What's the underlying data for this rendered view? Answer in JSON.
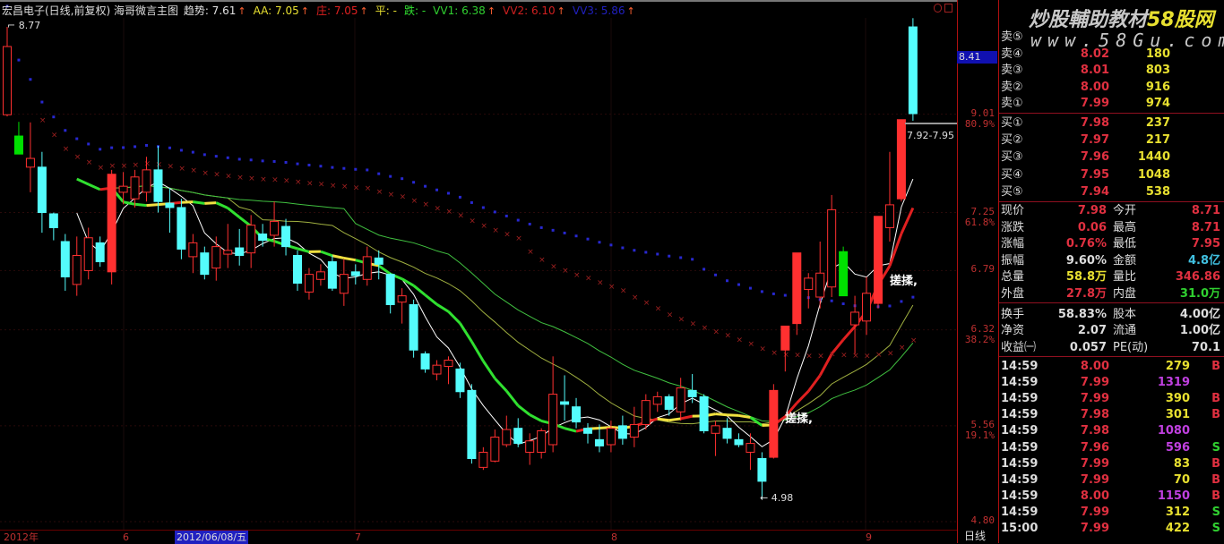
{
  "title": {
    "stock": "宏昌电子(日线,前复权) 海哥微言主图",
    "items": [
      {
        "text": "趋势: 7.61",
        "color": "#e0e0e0"
      },
      {
        "text": "AA: 7.05",
        "color": "#e8e030"
      },
      {
        "text": "庄: 7.05",
        "color": "#e02020"
      },
      {
        "text": "平: -",
        "color": "#e8e030"
      },
      {
        "text": "跌: -",
        "color": "#30e030"
      },
      {
        "text": "VV1: 6.38",
        "color": "#30d030"
      },
      {
        "text": "VV2: 6.10",
        "color": "#d02020"
      },
      {
        "text": "VV3: 5.86",
        "color": "#2020c0"
      }
    ],
    "arrow": "↑"
  },
  "axis": {
    "ticks": [
      {
        "value": 9.01,
        "label": "9.01",
        "pct": "80.9%"
      },
      {
        "value": 7.25,
        "label": "7.25",
        "pct": "61.8%"
      },
      {
        "value": 6.79,
        "label": "6.79",
        "pct": ""
      },
      {
        "value": 6.32,
        "label": "6.32",
        "pct": "38.2%"
      },
      {
        "value": 5.56,
        "label": "5.56",
        "pct": "19.1%"
      },
      {
        "value": 4.8,
        "label": "4.80",
        "pct": ""
      }
    ],
    "cursor_value": "8.41",
    "period": "日线"
  },
  "dates": {
    "year": "2012年",
    "m6": "6",
    "selected": "2012/06/08/五",
    "m7": "7",
    "m8": "8",
    "m9": "9"
  },
  "annotations": {
    "high": "8.77",
    "range": "7.92-7.95",
    "low": "4.98",
    "rub1": "搓揉,",
    "rub2": "搓揉,"
  },
  "colors": {
    "up": "#ff3030",
    "down": "#54fcfc",
    "limit": "#00e000",
    "bg": "#000000"
  },
  "chart_data": {
    "type": "candlestick",
    "fields": [
      "open",
      "high",
      "low",
      "close",
      "style"
    ],
    "candles": [
      [
        9.0,
        10.61,
        8.97,
        10.25,
        "up"
      ],
      [
        8.61,
        8.87,
        8.28,
        8.28,
        "limit"
      ],
      [
        8.04,
        8.86,
        7.58,
        8.2,
        "up"
      ],
      [
        8.04,
        8.32,
        7.09,
        7.25,
        "down"
      ],
      [
        7.24,
        7.25,
        7.03,
        7.13,
        "down"
      ],
      [
        7.02,
        7.08,
        6.63,
        6.74,
        "down"
      ],
      [
        6.68,
        7.06,
        6.59,
        6.91,
        "up"
      ],
      [
        6.79,
        7.13,
        6.72,
        7.05,
        "up"
      ],
      [
        7.01,
        7.06,
        6.82,
        6.86,
        "down"
      ],
      [
        6.78,
        7.99,
        6.68,
        7.91,
        "up_solid"
      ],
      [
        7.58,
        7.95,
        7.36,
        7.69,
        "up"
      ],
      [
        7.46,
        7.99,
        7.3,
        7.86,
        "up"
      ],
      [
        7.58,
        8.23,
        7.41,
        7.99,
        "up"
      ],
      [
        7.99,
        8.43,
        7.25,
        7.41,
        "down"
      ],
      [
        7.38,
        7.66,
        7.09,
        7.3,
        "down"
      ],
      [
        7.3,
        7.46,
        6.88,
        6.96,
        "down"
      ],
      [
        6.9,
        7.08,
        6.77,
        7.01,
        "up"
      ],
      [
        6.93,
        6.98,
        6.72,
        6.76,
        "down"
      ],
      [
        6.81,
        7.06,
        6.71,
        6.98,
        "up"
      ],
      [
        6.92,
        7.16,
        6.81,
        6.95,
        "up"
      ],
      [
        6.97,
        7.12,
        6.83,
        6.91,
        "down"
      ],
      [
        6.93,
        7.23,
        6.81,
        7.15,
        "up"
      ],
      [
        7.08,
        7.16,
        6.98,
        7.03,
        "down"
      ],
      [
        7.07,
        7.41,
        6.98,
        7.18,
        "up"
      ],
      [
        7.14,
        7.2,
        6.91,
        6.98,
        "down"
      ],
      [
        6.91,
        6.95,
        6.63,
        6.69,
        "down"
      ],
      [
        6.62,
        6.81,
        6.56,
        6.76,
        "up"
      ],
      [
        6.72,
        6.84,
        6.67,
        6.78,
        "up"
      ],
      [
        6.86,
        6.91,
        6.63,
        6.65,
        "down"
      ],
      [
        6.61,
        6.88,
        6.51,
        6.76,
        "up"
      ],
      [
        6.78,
        6.84,
        6.68,
        6.75,
        "down"
      ],
      [
        6.72,
        6.98,
        6.67,
        6.9,
        "up"
      ],
      [
        6.89,
        6.95,
        6.72,
        6.84,
        "down"
      ],
      [
        6.76,
        6.77,
        6.45,
        6.52,
        "down"
      ],
      [
        6.54,
        6.65,
        6.37,
        6.59,
        "up"
      ],
      [
        6.52,
        6.56,
        6.1,
        6.16,
        "down"
      ],
      [
        6.13,
        6.15,
        5.98,
        6.01,
        "down"
      ],
      [
        5.97,
        6.08,
        5.92,
        6.04,
        "up"
      ],
      [
        6.03,
        6.11,
        5.89,
        6.08,
        "up"
      ],
      [
        6.01,
        6.06,
        5.78,
        5.83,
        "down"
      ],
      [
        5.84,
        5.89,
        5.26,
        5.3,
        "down"
      ],
      [
        5.23,
        5.39,
        5.21,
        5.35,
        "up"
      ],
      [
        5.28,
        5.53,
        5.27,
        5.47,
        "up"
      ],
      [
        5.41,
        5.64,
        5.39,
        5.53,
        "up"
      ],
      [
        5.54,
        5.62,
        5.39,
        5.42,
        "down"
      ],
      [
        5.35,
        5.5,
        5.25,
        5.44,
        "up"
      ],
      [
        5.35,
        5.54,
        5.3,
        5.52,
        "up"
      ],
      [
        5.41,
        6.11,
        5.35,
        5.81,
        "up"
      ],
      [
        5.75,
        5.96,
        5.6,
        5.73,
        "down"
      ],
      [
        5.71,
        5.78,
        5.54,
        5.59,
        "down"
      ],
      [
        5.54,
        5.58,
        5.42,
        5.5,
        "down"
      ],
      [
        5.45,
        5.57,
        5.35,
        5.4,
        "down"
      ],
      [
        5.41,
        5.6,
        5.35,
        5.54,
        "up"
      ],
      [
        5.56,
        5.64,
        5.41,
        5.46,
        "down"
      ],
      [
        5.47,
        5.71,
        5.39,
        5.57,
        "up"
      ],
      [
        5.57,
        5.81,
        5.53,
        5.76,
        "up"
      ],
      [
        5.73,
        5.83,
        5.67,
        5.79,
        "up"
      ],
      [
        5.79,
        5.81,
        5.64,
        5.69,
        "down"
      ],
      [
        5.67,
        5.94,
        5.6,
        5.86,
        "up"
      ],
      [
        5.84,
        5.97,
        5.74,
        5.79,
        "down"
      ],
      [
        5.79,
        5.81,
        5.5,
        5.52,
        "down"
      ],
      [
        5.5,
        5.6,
        5.32,
        5.56,
        "up"
      ],
      [
        5.54,
        5.62,
        5.42,
        5.46,
        "down"
      ],
      [
        5.45,
        5.5,
        5.39,
        5.41,
        "down"
      ],
      [
        5.35,
        5.5,
        5.21,
        5.42,
        "up"
      ],
      [
        5.3,
        5.35,
        4.98,
        5.12,
        "down"
      ],
      [
        5.31,
        5.89,
        5.3,
        5.84,
        "up_solid"
      ],
      [
        6.16,
        6.35,
        5.99,
        6.35,
        "up_solid"
      ],
      [
        6.37,
        6.93,
        6.28,
        6.93,
        "up_solid"
      ],
      [
        6.64,
        6.77,
        6.49,
        6.73,
        "up"
      ],
      [
        6.58,
        7.02,
        6.49,
        6.77,
        "up"
      ],
      [
        6.66,
        7.53,
        6.58,
        7.26,
        "up"
      ],
      [
        6.94,
        6.98,
        6.59,
        6.59,
        "limit"
      ],
      [
        6.36,
        6.59,
        6.13,
        6.46,
        "up"
      ],
      [
        6.39,
        6.74,
        6.28,
        6.61,
        "up"
      ],
      [
        6.53,
        7.22,
        6.49,
        7.22,
        "up_solid"
      ],
      [
        7.13,
        8.32,
        7.02,
        7.35,
        "up"
      ],
      [
        7.46,
        8.91,
        7.41,
        8.91,
        "up_solid"
      ],
      [
        10.61,
        10.77,
        8.89,
        9.02,
        "down"
      ]
    ],
    "indicators": [
      "MA5",
      "MA10",
      "MA20",
      "MA30",
      "MA60"
    ]
  },
  "panel": {
    "watermark1": "炒股輔助教材",
    "watermark1b": "58股网",
    "watermark2": "www.58Gu.com",
    "asks": [
      {
        "label": "卖⑤",
        "price": "",
        "vol": ""
      },
      {
        "label": "卖④",
        "price": "8.02",
        "vol": "180"
      },
      {
        "label": "卖③",
        "price": "8.01",
        "vol": "803"
      },
      {
        "label": "卖②",
        "price": "8.00",
        "vol": "916"
      },
      {
        "label": "卖①",
        "price": "7.99",
        "vol": "974"
      }
    ],
    "bids": [
      {
        "label": "买①",
        "price": "7.98",
        "vol": "237"
      },
      {
        "label": "买②",
        "price": "7.97",
        "vol": "217"
      },
      {
        "label": "买③",
        "price": "7.96",
        "vol": "1440"
      },
      {
        "label": "买④",
        "price": "7.95",
        "vol": "1048"
      },
      {
        "label": "买⑤",
        "price": "7.94",
        "vol": "538"
      }
    ],
    "quote": [
      {
        "l1": "现价",
        "v1": "7.98",
        "c1": "#e03040",
        "l2": "今开",
        "v2": "8.71",
        "c2": "#e03040"
      },
      {
        "l1": "涨跌",
        "v1": "0.06",
        "c1": "#e03040",
        "l2": "最高",
        "v2": "8.71",
        "c2": "#e03040"
      },
      {
        "l1": "涨幅",
        "v1": "0.76%",
        "c1": "#e03040",
        "l2": "最低",
        "v2": "7.95",
        "c2": "#e03040"
      },
      {
        "l1": "振幅",
        "v1": "9.60%",
        "c1": "#dddddd",
        "l2": "金额",
        "v2": "4.8亿",
        "c2": "#40c0e0"
      },
      {
        "l1": "总量",
        "v1": "58.8万",
        "c1": "#e8e030",
        "l2": "量比",
        "v2": "346.86",
        "c2": "#e03040"
      },
      {
        "l1": "外盘",
        "v1": "27.8万",
        "c1": "#e03040",
        "l2": "内盘",
        "v2": "31.0万",
        "c2": "#30d030"
      }
    ],
    "fundamentals": [
      {
        "l1": "换手",
        "v1": "58.83%",
        "l2": "股本",
        "v2": "4.00亿"
      },
      {
        "l1": "净资",
        "v1": "2.07",
        "l2": "流通",
        "v2": "1.00亿"
      },
      {
        "l1": "收益㈠",
        "v1": "0.057",
        "l2": "PE(动)",
        "v2": "70.1"
      }
    ],
    "ticks": [
      {
        "time": "14:59",
        "price": "8.00",
        "vol": "279",
        "flag": "B",
        "big": false
      },
      {
        "time": "14:59",
        "price": "7.99",
        "vol": "1319",
        "flag": "",
        "big": true
      },
      {
        "time": "14:59",
        "price": "7.99",
        "vol": "390",
        "flag": "B",
        "big": false
      },
      {
        "time": "14:59",
        "price": "7.98",
        "vol": "301",
        "flag": "B",
        "big": false
      },
      {
        "time": "14:59",
        "price": "7.98",
        "vol": "1080",
        "flag": "",
        "big": true
      },
      {
        "time": "14:59",
        "price": "7.96",
        "vol": "596",
        "flag": "S",
        "big": true
      },
      {
        "time": "14:59",
        "price": "7.99",
        "vol": "83",
        "flag": "B",
        "big": false
      },
      {
        "time": "14:59",
        "price": "7.99",
        "vol": "70",
        "flag": "B",
        "big": false
      },
      {
        "time": "14:59",
        "price": "8.00",
        "vol": "1150",
        "flag": "B",
        "big": true
      },
      {
        "time": "14:59",
        "price": "7.99",
        "vol": "312",
        "flag": "S",
        "big": false
      },
      {
        "time": "15:00",
        "price": "7.99",
        "vol": "422",
        "flag": "S",
        "big": false
      }
    ]
  }
}
